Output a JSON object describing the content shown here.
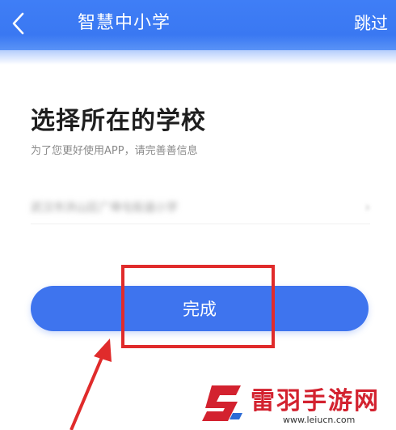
{
  "header": {
    "title": "智慧中小学",
    "skip_label": "跳过",
    "back_icon": "chevron-left-icon"
  },
  "form": {
    "heading": "选择所在的学校",
    "subtitle": "为了您更好使用APP，请完善善信息",
    "school_value": "武汉市洪山区广埠屯街道小学",
    "submit_label": "完成"
  },
  "watermark": {
    "name": "雷羽手游网",
    "url": "www.leiucn.com"
  },
  "colors": {
    "primary": "#3e74ee",
    "annotation": "#e02b2b",
    "brand": "#d3222f"
  }
}
